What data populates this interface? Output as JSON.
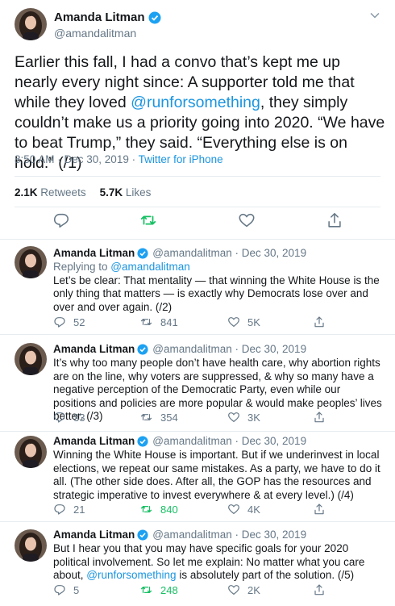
{
  "main_tweet": {
    "name": "Amanda Litman",
    "handle": "@amandalitman",
    "text_parts": [
      "Earlier this fall, I had a convo that’s kept me up nearly every night since: A supporter told me that while they loved ",
      "@runforsomething",
      ", they simply couldn’t make us a priority going into 2020. “We have to beat Trump,” they said. “Everything else is on hold.” (/1)"
    ],
    "time": "8:50 AM · Dec 30, 2019 · ",
    "client": "Twitter for iPhone",
    "retweets_count": "2.1K",
    "retweets_label": "Retweets",
    "likes_count": "5.7K",
    "likes_label": "Likes"
  },
  "replies": [
    {
      "name": "Amanda Litman",
      "meta": "@amandalitman · Dec 30, 2019",
      "replying_to_prefix": "Replying to ",
      "replying_to_handle": "@amandalitman",
      "text": "Let’s be clear: That mentality — that winning the White House is the only thing that matters — is exactly why Democrats lose over and over and over again. (/2)",
      "replies": "52",
      "retweets": "841",
      "likes": "5K",
      "retweeted": false
    },
    {
      "name": "Amanda Litman",
      "meta": "@amandalitman · Dec 30, 2019",
      "text": "It’s why too many people don’t have health care, why abortion rights are on the line, why voters are suppressed, & why so many have a negative perception of the Democratic Party, even while our positions and policies are more popular & would make peoples’ lives better. (/3)",
      "replies": "33",
      "retweets": "354",
      "likes": "3K",
      "retweeted": false
    },
    {
      "name": "Amanda Litman",
      "meta": "@amandalitman · Dec 30, 2019",
      "text": "Winning the White House is important. But if we underinvest in local elections, we repeat our same mistakes. As a party, we have to do it all. (The other side does. After all, the GOP has the resources and strategic imperative to invest everywhere & at every level.) (/4)",
      "replies": "21",
      "retweets": "840",
      "likes": "4K",
      "retweeted": true
    },
    {
      "name": "Amanda Litman",
      "meta": "@amandalitman · Dec 30, 2019",
      "text_before": "But I hear you that you may have specific goals for your 2020 political involvement. So let me explain: No matter what you care about, ",
      "link": "@runforsomething",
      "text_after": " is absolutely part of the solution. (/5)",
      "replies": "5",
      "retweets": "248",
      "likes": "2K",
      "retweeted": true
    }
  ],
  "colors": {
    "link": "#1b95e0",
    "verified": "#1da1f2",
    "retweet_active": "#17bf63",
    "secondary_text": "#657786"
  },
  "icons": [
    "verified-badge-icon",
    "chevron-down-icon",
    "reply-icon",
    "retweet-icon",
    "like-icon",
    "share-icon"
  ]
}
